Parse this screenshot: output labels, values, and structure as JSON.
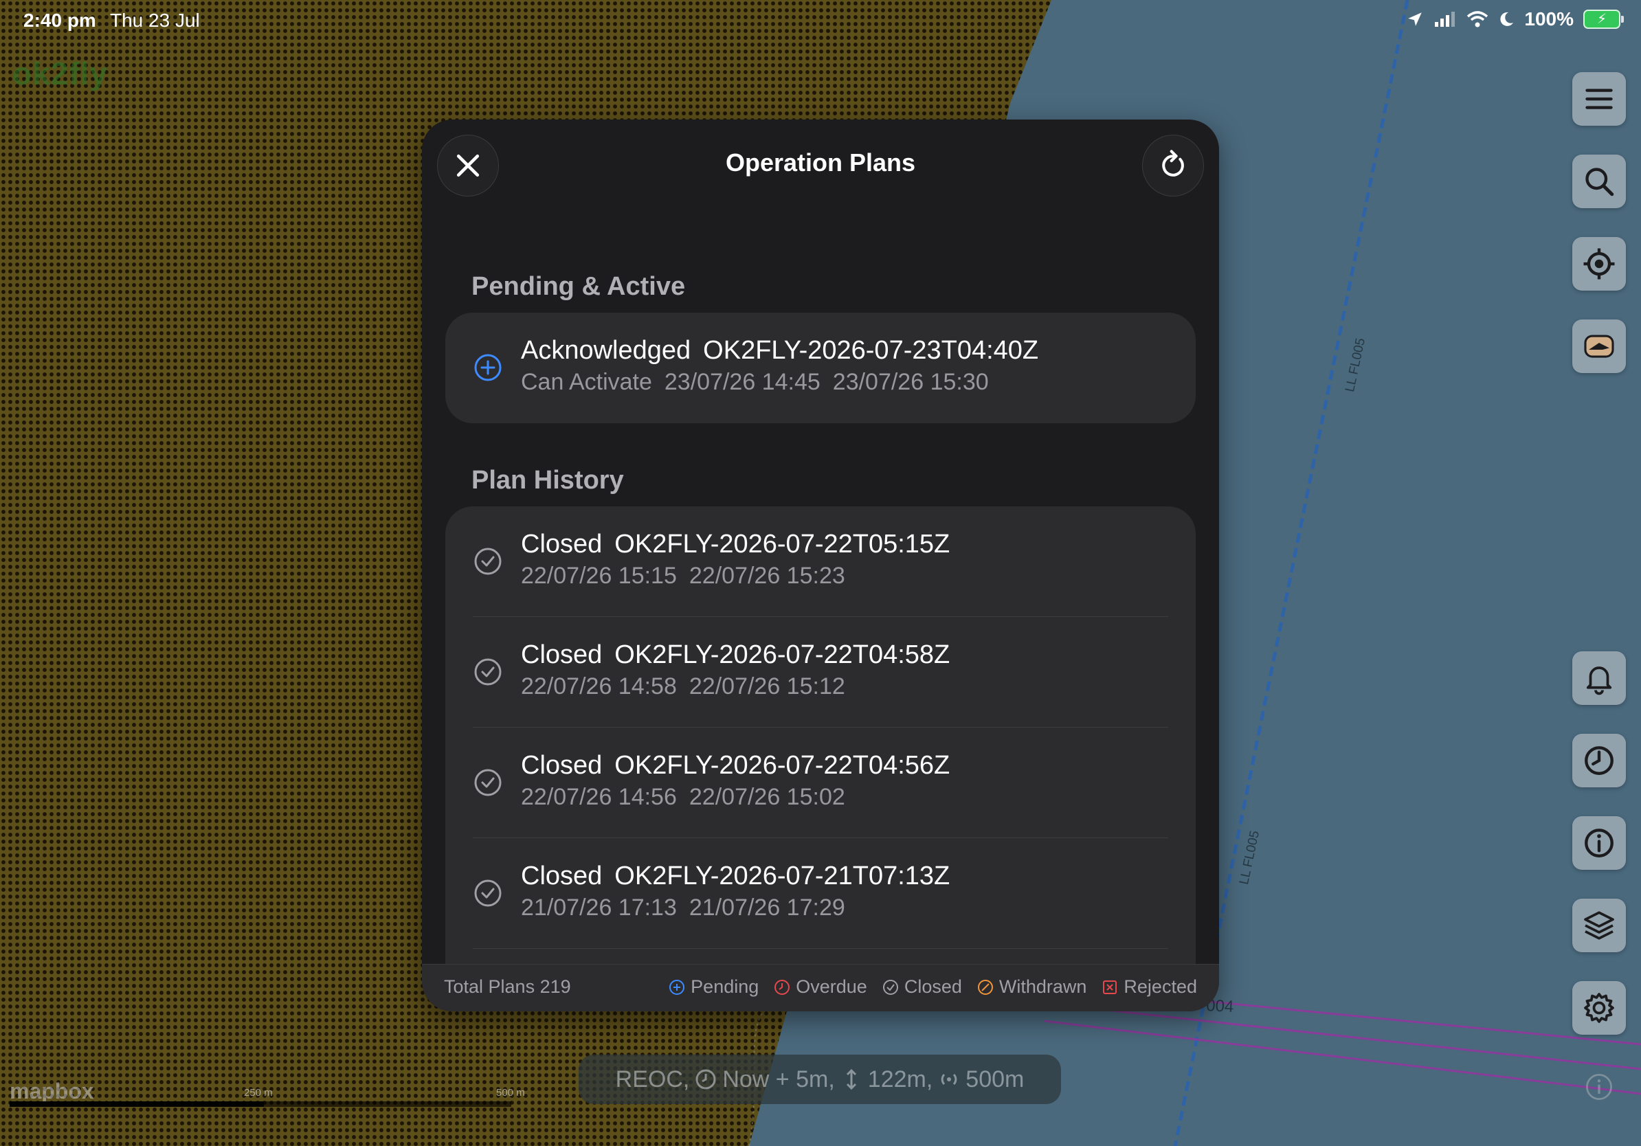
{
  "status_bar": {
    "time": "2:40 pm",
    "date": "Thu 23 Jul",
    "battery": "100%"
  },
  "brand": "ok2fly",
  "map_labels": {
    "airspace_1": "LL FL005",
    "airspace_2": "LL FL005",
    "airspace_3": "004"
  },
  "modal": {
    "title": "Operation Plans",
    "sections": {
      "active_title": "Pending & Active",
      "history_title": "Plan History"
    },
    "active_plans": [
      {
        "status": "Acknowledged",
        "id": "OK2FLY-2026-07-23T04:40Z",
        "substatus": "Can Activate",
        "start": "23/07/26 14:45",
        "end": "23/07/26 15:30",
        "icon": "plus-circle-icon"
      }
    ],
    "history": [
      {
        "status": "Closed",
        "id": "OK2FLY-2026-07-22T05:15Z",
        "start": "22/07/26 15:15",
        "end": "22/07/26 15:23",
        "icon": "check-circle-icon"
      },
      {
        "status": "Closed",
        "id": "OK2FLY-2026-07-22T04:58Z",
        "start": "22/07/26 14:58",
        "end": "22/07/26 15:12",
        "icon": "check-circle-icon"
      },
      {
        "status": "Closed",
        "id": "OK2FLY-2026-07-22T04:56Z",
        "start": "22/07/26 14:56",
        "end": "22/07/26 15:02",
        "icon": "check-circle-icon"
      },
      {
        "status": "Closed",
        "id": "OK2FLY-2026-07-21T07:13Z",
        "start": "21/07/26 17:13",
        "end": "21/07/26 17:29",
        "icon": "check-circle-icon"
      }
    ],
    "footer": {
      "total": "Total Plans 219",
      "legend": [
        {
          "label": "Pending",
          "color": "#3d8bff"
        },
        {
          "label": "Overdue",
          "color": "#e5484d"
        },
        {
          "label": "Closed",
          "color": "#a0a0a5"
        },
        {
          "label": "Withdrawn",
          "color": "#f0953a"
        },
        {
          "label": "Rejected",
          "color": "#e5484d"
        }
      ]
    }
  },
  "info_pill": {
    "area": "REOC,",
    "time": "Now + 5m,",
    "height": "122m,",
    "radius": "500m"
  },
  "map_footer": {
    "attribution": "mapbox",
    "scale_mid": "250 m",
    "scale_end": "500 m"
  },
  "colors": {
    "accent_blue": "#3d8bff",
    "modal_bg": "#1c1c1e",
    "card_bg": "#2c2c2e"
  }
}
